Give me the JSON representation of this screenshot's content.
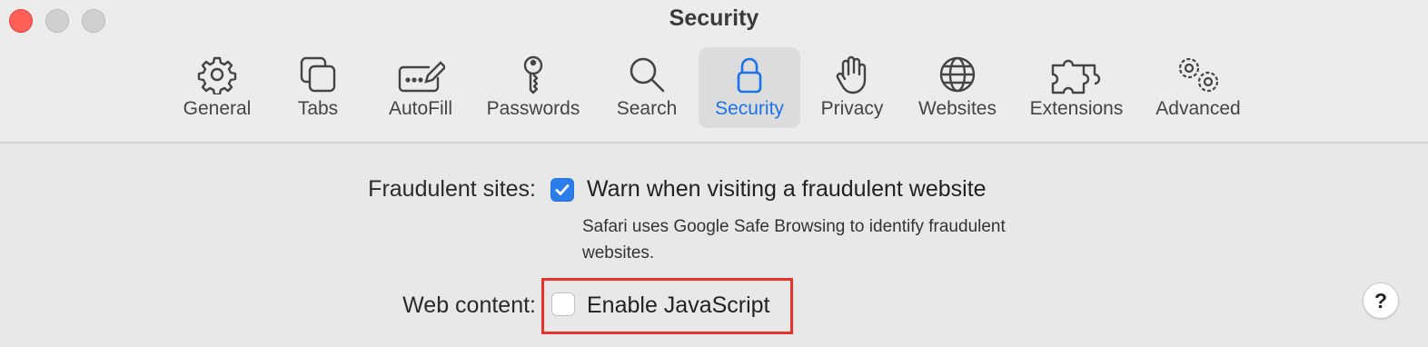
{
  "window": {
    "title": "Security"
  },
  "toolbar": {
    "items": [
      {
        "label": "General",
        "icon": "gear-icon"
      },
      {
        "label": "Tabs",
        "icon": "tabs-icon"
      },
      {
        "label": "AutoFill",
        "icon": "autofill-icon"
      },
      {
        "label": "Passwords",
        "icon": "key-icon"
      },
      {
        "label": "Search",
        "icon": "search-icon"
      },
      {
        "label": "Security",
        "icon": "lock-icon",
        "active": true
      },
      {
        "label": "Privacy",
        "icon": "hand-icon"
      },
      {
        "label": "Websites",
        "icon": "globe-icon"
      },
      {
        "label": "Extensions",
        "icon": "puzzle-icon"
      },
      {
        "label": "Advanced",
        "icon": "gears-icon"
      }
    ]
  },
  "settings": {
    "fraudulent": {
      "label": "Fraudulent sites:",
      "option": "Warn when visiting a fraudulent website",
      "checked": true,
      "description": "Safari uses Google Safe Browsing to identify fraudulent websites."
    },
    "web_content": {
      "label": "Web content:",
      "option": "Enable JavaScript",
      "checked": false
    }
  },
  "help": {
    "label": "?"
  },
  "colors": {
    "accent": "#2b7de9",
    "highlight": "#e8322b",
    "close": "#fe5f57"
  }
}
